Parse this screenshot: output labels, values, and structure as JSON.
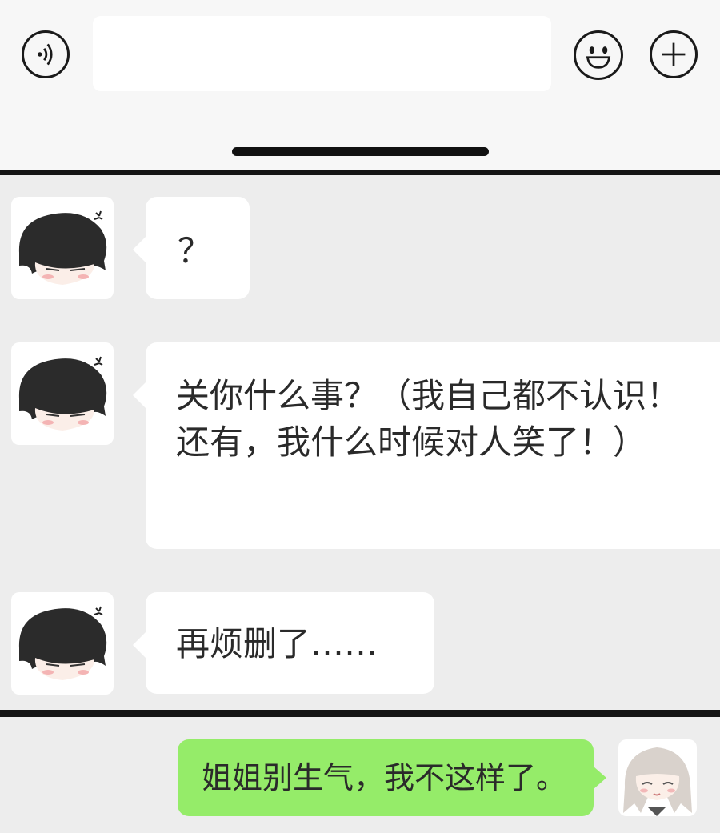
{
  "input_bar": {
    "voice_icon": "voice-icon",
    "text_value": "",
    "emoji_icon": "smiley-icon",
    "plus_icon": "plus-icon"
  },
  "messages": [
    {
      "side": "left",
      "avatar": "dark-haired-chibi-avatar",
      "text": "？"
    },
    {
      "side": "left",
      "avatar": "dark-haired-chibi-avatar",
      "text": "关你什么事？（我自己都不认识！还有，我什么时候对人笑了！）"
    },
    {
      "side": "left",
      "avatar": "dark-haired-chibi-avatar",
      "text": "再烦删了……"
    },
    {
      "side": "right",
      "avatar": "silver-haired-chibi-avatar",
      "text": "姐姐别生气，我不这样了。"
    }
  ],
  "colors": {
    "background": "#ededed",
    "incoming_bubble": "#ffffff",
    "outgoing_bubble": "#95ec69",
    "divider": "#151515"
  }
}
